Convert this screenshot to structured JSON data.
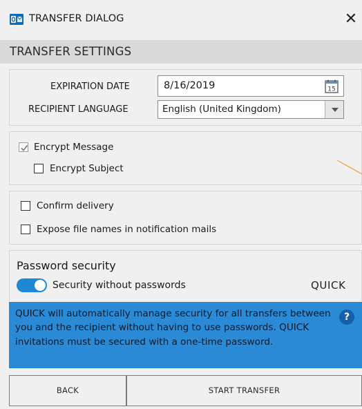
{
  "window": {
    "title": "TRANSFER DIALOG",
    "close_glyph": "✕",
    "app_icon": "outlook-icon"
  },
  "header": {
    "title": "TRANSFER SETTINGS"
  },
  "fields": {
    "expiration_label": "EXPIRATION DATE",
    "expiration_value": "8/16/2019",
    "calendar_day": "15",
    "language_label": "RECIPIENT LANGUAGE",
    "language_value": "English (United Kingdom)"
  },
  "encryption": {
    "encrypt_message_label": "Encrypt Message",
    "encrypt_message_checked": true,
    "encrypt_subject_label": "Encrypt Subject",
    "encrypt_subject_checked": false
  },
  "options": {
    "confirm_delivery_label": "Confirm delivery",
    "confirm_delivery_checked": false,
    "expose_names_label": "Expose file names in notification mails",
    "expose_names_checked": false
  },
  "password": {
    "title": "Password security",
    "toggle_on": true,
    "toggle_label": "Security without passwords",
    "mode_label": "QUICK",
    "info_text": "QUICK will automatically manage security for all transfers between you and the recipient without having to use passwords. QUICK invitations must be secured with a one-time password.",
    "info_icon_glyph": "?"
  },
  "buttons": {
    "back_label": "BACK",
    "start_label": "START TRANSFER"
  },
  "colors": {
    "accent": "#1e88d4",
    "info_bg": "#2a8ad6",
    "header_bg": "#d9d9d9",
    "window_bg": "#f0f0f0",
    "annotation_line": "#f0a030"
  }
}
